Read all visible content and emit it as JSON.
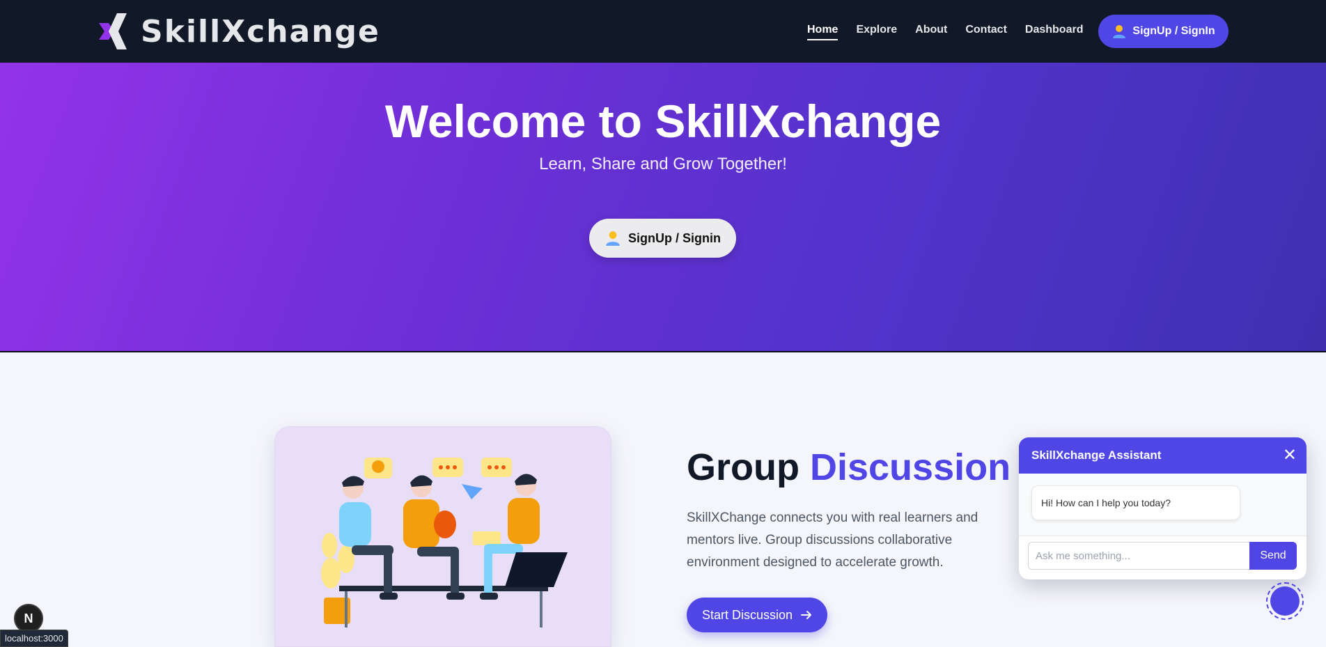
{
  "brand": {
    "name": "SkillXchange",
    "accent": "#4f46e5",
    "purple": "#9333ea"
  },
  "nav": {
    "links": [
      {
        "label": "Home",
        "active": true
      },
      {
        "label": "Explore",
        "active": false
      },
      {
        "label": "About",
        "active": false
      },
      {
        "label": "Contact",
        "active": false
      },
      {
        "label": "Dashboard",
        "active": false
      }
    ],
    "cta_label": "SignUp / SignIn",
    "cta_icon": "user-icon"
  },
  "hero": {
    "title": "Welcome to SkillXchange",
    "subtitle": "Learn, Share and Grow Together!",
    "cta_label": "SignUp / Signin",
    "cta_icon": "user-icon"
  },
  "feature": {
    "title_plain": "Group ",
    "title_accent": "Discussion",
    "description": "SkillXChange connects you with real learners and mentors live. Group discussions collaborative environment designed to accelerate growth.",
    "button_label": "Start Discussion",
    "button_icon": "arrow-right-icon",
    "illustration": "group-discussion-illustration"
  },
  "chat": {
    "title": "SkillXchange Assistant",
    "close_icon": "close-icon",
    "messages": [
      {
        "from": "assistant",
        "text": "Hi! How can I help you today?"
      }
    ],
    "input_placeholder": "Ask me something...",
    "send_label": "Send"
  },
  "dev": {
    "badge": "N",
    "status_url": "localhost:3000"
  }
}
